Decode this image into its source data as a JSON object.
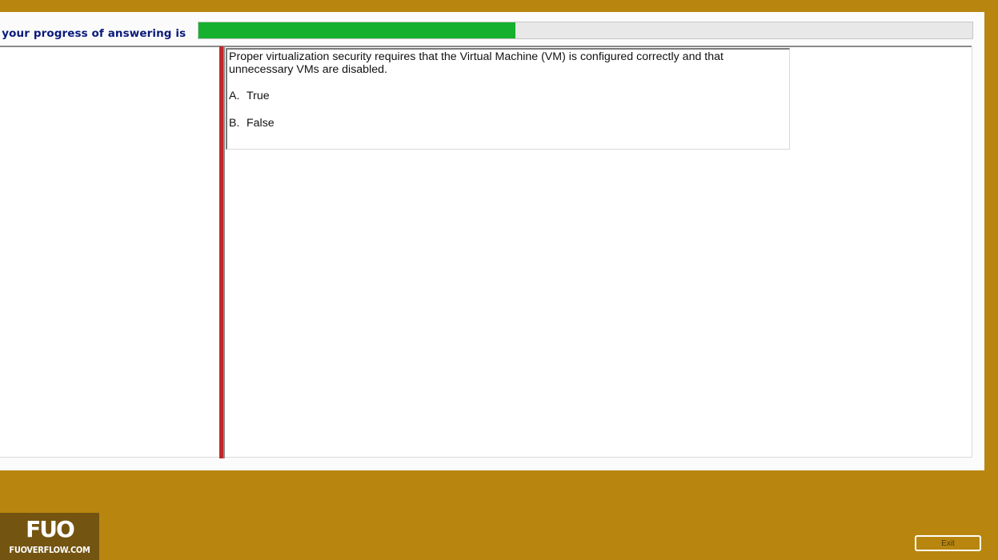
{
  "header": {
    "progress_label": "nd your progress of answering is",
    "progress_fraction": 0.41
  },
  "question": {
    "text": "Proper virtualization security requires that the Virtual Machine (VM) is configured correctly and that unnecessary VMs are disabled.",
    "options": [
      {
        "letter": "A.",
        "label": "True"
      },
      {
        "letter": "B.",
        "label": "False"
      }
    ]
  },
  "footer": {
    "exit_label": "Exit"
  },
  "watermark": {
    "logo_mark": "FUO",
    "site": "FUOVERFLOW.COM"
  },
  "colors": {
    "frame_background": "#b8860f",
    "progress_fill": "#14b02e",
    "accent_bar": "#c0282a",
    "label_color": "#0a1a7a"
  }
}
